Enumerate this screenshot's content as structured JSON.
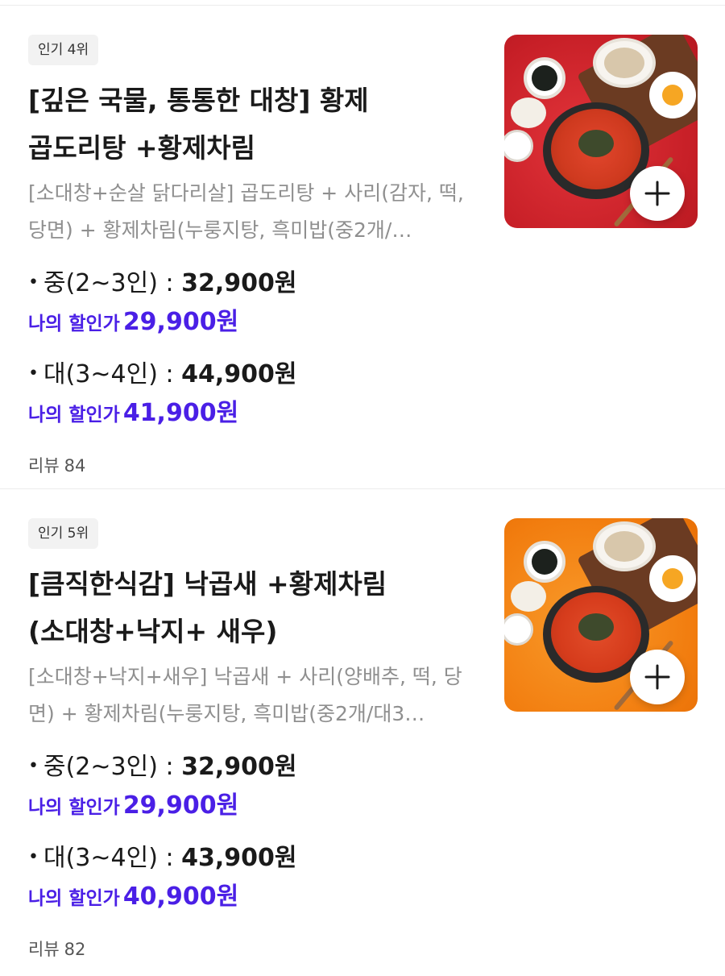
{
  "products": [
    {
      "badge": "인기 4위",
      "title": "[깊은 국물, 통통한 대창] 황제 곱도리탕 +황제차림",
      "description": "[소대창+순살 닭다리살] 곱도리탕 + 사리(감자, 떡, 당면) + 황제차림(누룽지탕, 흑미밥(중2개/…",
      "options": [
        {
          "bullet": "•",
          "label": "중(2~3인) :",
          "price": "32,900원",
          "discount_label": "나의 할인가",
          "discount_price": "29,900원"
        },
        {
          "bullet": "•",
          "label": "대(3~4인) :",
          "price": "44,900원",
          "discount_label": "나의 할인가",
          "discount_price": "41,900원"
        }
      ],
      "review_label": "리뷰",
      "review_count": "84"
    },
    {
      "badge": "인기 5위",
      "title": "[큼직한식감] 낙곱새 +황제차림(소대창+낙지+ 새우)",
      "description": "[소대창+낙지+새우] 낙곱새 + 사리(양배추, 떡, 당면) + 황제차림(누룽지탕, 흑미밥(중2개/대3…",
      "options": [
        {
          "bullet": "•",
          "label": "중(2~3인) :",
          "price": "32,900원",
          "discount_label": "나의 할인가",
          "discount_price": "29,900원"
        },
        {
          "bullet": "•",
          "label": "대(3~4인) :",
          "price": "43,900원",
          "discount_label": "나의 할인가",
          "discount_price": "40,900원"
        }
      ],
      "review_label": "리뷰",
      "review_count": "82"
    }
  ],
  "icons": {
    "add": "plus-icon"
  },
  "colors": {
    "discount": "#4a1fe6",
    "badge_bg": "#f2f2f2",
    "description": "#8f8f8f"
  }
}
